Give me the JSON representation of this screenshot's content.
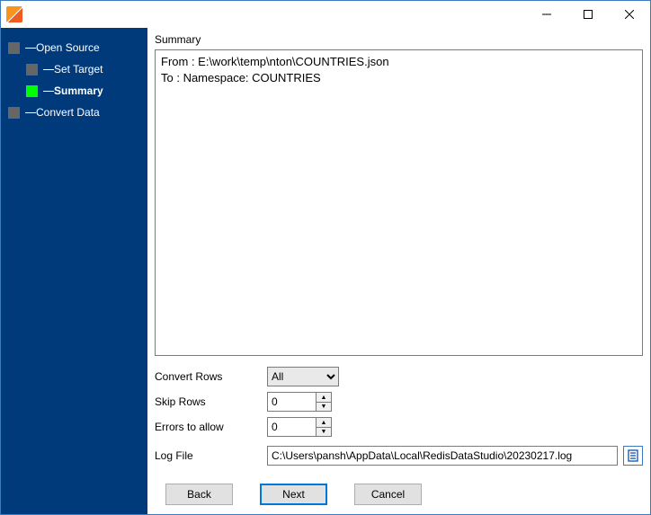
{
  "titlebar": {
    "title": ""
  },
  "nav": {
    "items": [
      {
        "label": "Open Source",
        "active": false
      },
      {
        "label": "Set Target",
        "active": false
      },
      {
        "label": "Summary",
        "active": true
      },
      {
        "label": "Convert Data",
        "active": false
      }
    ]
  },
  "main": {
    "section_title": "Summary",
    "summary_text": "From : E:\\work\\temp\\nton\\COUNTRIES.json\nTo : Namespace: COUNTRIES",
    "fields": {
      "convert_rows_label": "Convert Rows",
      "convert_rows_value": "All",
      "skip_rows_label": "Skip Rows",
      "skip_rows_value": "0",
      "errors_label": "Errors to allow",
      "errors_value": "0",
      "logfile_label": "Log File",
      "logfile_value": "C:\\Users\\pansh\\AppData\\Local\\RedisDataStudio\\20230217.log"
    }
  },
  "buttons": {
    "back": "Back",
    "next": "Next",
    "cancel": "Cancel"
  }
}
